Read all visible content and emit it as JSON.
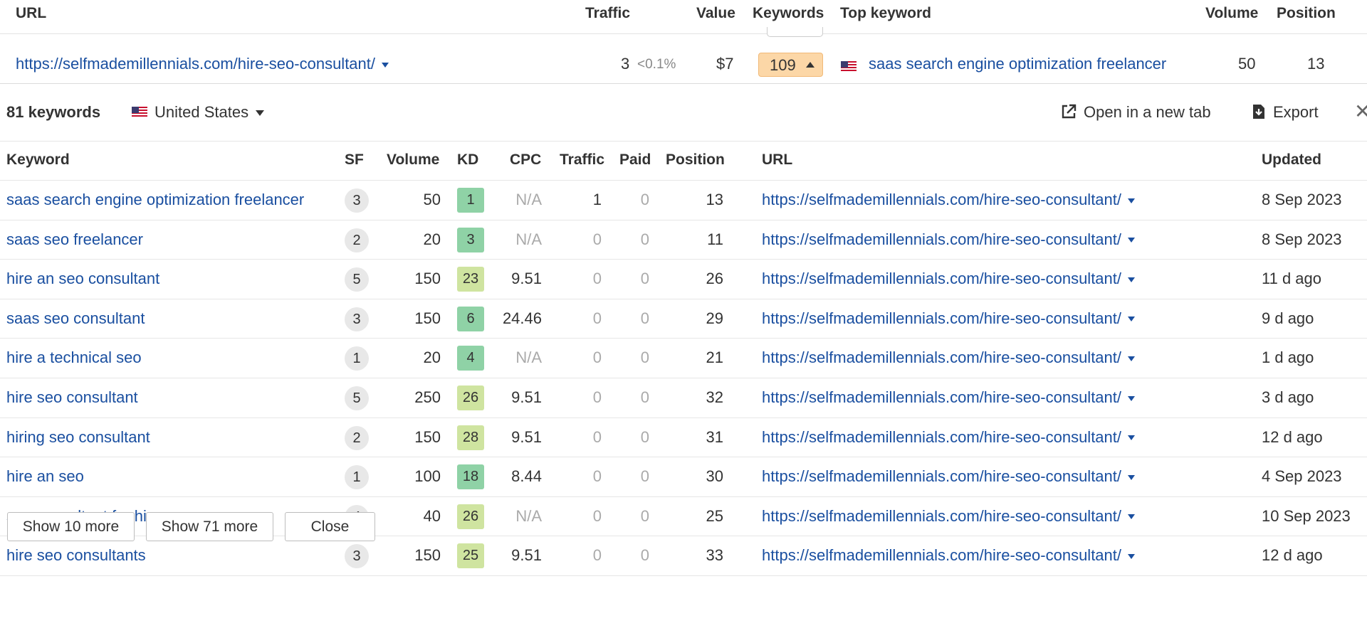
{
  "outer": {
    "headers": {
      "url": "URL",
      "traffic": "Traffic",
      "value": "Value",
      "keywords": "Keywords",
      "top_keyword": "Top keyword",
      "volume": "Volume",
      "position": "Position"
    },
    "row": {
      "url": "https://selfmademillennials.com/hire-seo-consultant/",
      "traffic": "3",
      "traffic_pct": "<0.1%",
      "value": "$7",
      "keywords": "109",
      "top_keyword": "saas search engine optimization freelancer",
      "volume": "50",
      "position": "13"
    }
  },
  "panel": {
    "title": "81 keywords",
    "country": "United States",
    "open_tab": "Open in a new tab",
    "export": "Export",
    "close_symbol": "✕",
    "columns": {
      "keyword": "Keyword",
      "sf": "SF",
      "volume": "Volume",
      "kd": "KD",
      "cpc": "CPC",
      "traffic": "Traffic",
      "paid": "Paid",
      "position": "Position",
      "url": "URL",
      "updated": "Updated"
    },
    "rows": [
      {
        "keyword": "saas search engine optimization freelancer",
        "sf": "3",
        "volume": "50",
        "kd": "1",
        "cpc": "N/A",
        "traffic": "1",
        "paid": "0",
        "position": "13",
        "url": "https://selfmademillennials.com/hire-seo-consultant/",
        "updated": "8 Sep 2023"
      },
      {
        "keyword": "saas seo freelancer",
        "sf": "2",
        "volume": "20",
        "kd": "3",
        "cpc": "N/A",
        "traffic": "0",
        "paid": "0",
        "position": "11",
        "url": "https://selfmademillennials.com/hire-seo-consultant/",
        "updated": "8 Sep 2023"
      },
      {
        "keyword": "hire an seo consultant",
        "sf": "5",
        "volume": "150",
        "kd": "23",
        "cpc": "9.51",
        "traffic": "0",
        "paid": "0",
        "position": "26",
        "url": "https://selfmademillennials.com/hire-seo-consultant/",
        "updated": "11 d ago"
      },
      {
        "keyword": "saas seo consultant",
        "sf": "3",
        "volume": "150",
        "kd": "6",
        "cpc": "24.46",
        "traffic": "0",
        "paid": "0",
        "position": "29",
        "url": "https://selfmademillennials.com/hire-seo-consultant/",
        "updated": "9 d ago"
      },
      {
        "keyword": "hire a technical seo",
        "sf": "1",
        "volume": "20",
        "kd": "4",
        "cpc": "N/A",
        "traffic": "0",
        "paid": "0",
        "position": "21",
        "url": "https://selfmademillennials.com/hire-seo-consultant/",
        "updated": "1 d ago"
      },
      {
        "keyword": "hire seo consultant",
        "sf": "5",
        "volume": "250",
        "kd": "26",
        "cpc": "9.51",
        "traffic": "0",
        "paid": "0",
        "position": "32",
        "url": "https://selfmademillennials.com/hire-seo-consultant/",
        "updated": "3 d ago"
      },
      {
        "keyword": "hiring seo consultant",
        "sf": "2",
        "volume": "150",
        "kd": "28",
        "cpc": "9.51",
        "traffic": "0",
        "paid": "0",
        "position": "31",
        "url": "https://selfmademillennials.com/hire-seo-consultant/",
        "updated": "12 d ago"
      },
      {
        "keyword": "hire an seo",
        "sf": "1",
        "volume": "100",
        "kd": "18",
        "cpc": "8.44",
        "traffic": "0",
        "paid": "0",
        "position": "30",
        "url": "https://selfmademillennials.com/hire-seo-consultant/",
        "updated": "4 Sep 2023"
      },
      {
        "keyword": "seo consultant for hire",
        "sf": "4",
        "volume": "40",
        "kd": "26",
        "cpc": "N/A",
        "traffic": "0",
        "paid": "0",
        "position": "25",
        "url": "https://selfmademillennials.com/hire-seo-consultant/",
        "updated": "10 Sep 2023"
      },
      {
        "keyword": "hire seo consultants",
        "sf": "3",
        "volume": "150",
        "kd": "25",
        "cpc": "9.51",
        "traffic": "0",
        "paid": "0",
        "position": "33",
        "url": "https://selfmademillennials.com/hire-seo-consultant/",
        "updated": "12 d ago"
      }
    ],
    "buttons": {
      "show_10": "Show 10 more",
      "show_71": "Show 71 more",
      "close": "Close"
    }
  },
  "colors": {
    "link": "#1a4fa0",
    "kd_easy": "#8fd2a6",
    "kd_medium": "#cfe4a0",
    "keywords_badge": "#fcd7a7",
    "muted": "#aaaaaa"
  }
}
